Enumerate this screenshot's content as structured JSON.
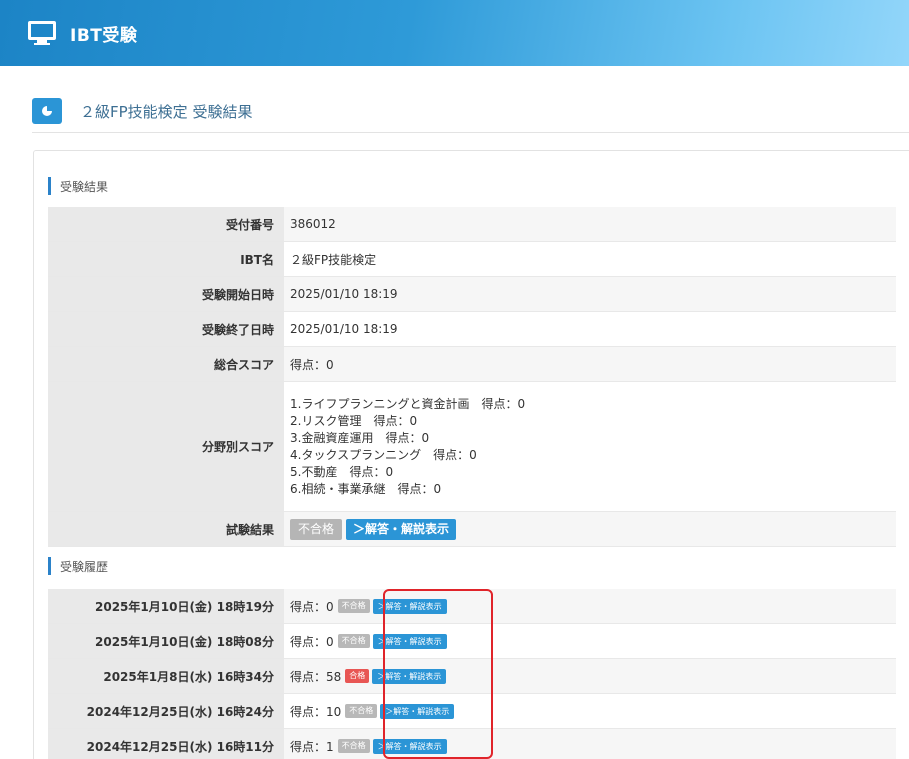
{
  "app": {
    "title": "IBT受験"
  },
  "page": {
    "title": "２級FP技能検定 受験結果"
  },
  "results": {
    "section_label": "受験結果",
    "rows": [
      {
        "key": "受付番号",
        "value": "386012"
      },
      {
        "key": "IBT名",
        "value": "２級FP技能検定"
      },
      {
        "key": "受験開始日時",
        "value": "2025/01/10 18:19"
      },
      {
        "key": "受験終了日時",
        "value": "2025/01/10 18:19"
      },
      {
        "key": "総合スコア",
        "value": "得点：0"
      }
    ],
    "category_label": "分野別スコア",
    "categories": [
      "1.ライフプランニングと資金計画　得点：0",
      "2.リスク管理　得点：0",
      "3.金融資産運用　得点：0",
      "4.タックスプランニング　得点：0",
      "5.不動産　得点：0",
      "6.相続・事業承継　得点：0"
    ],
    "result_label": "試験結果",
    "result_badge": "不合格",
    "answer_button": "＞解答・解説表示"
  },
  "history": {
    "section_label": "受験履歴",
    "rows": [
      {
        "datetime": "2025年1月10日(金) 18時19分",
        "score": "得点：0",
        "status": "不合格",
        "status_type": "fail",
        "button": "＞解答・解説表示"
      },
      {
        "datetime": "2025年1月10日(金) 18時08分",
        "score": "得点：0",
        "status": "不合格",
        "status_type": "fail",
        "button": "＞解答・解説表示"
      },
      {
        "datetime": "2025年1月8日(水) 16時34分",
        "score": "得点：58",
        "status": "合格",
        "status_type": "pass",
        "button": "＞解答・解説表示"
      },
      {
        "datetime": "2024年12月25日(水) 16時24分",
        "score": "得点：10",
        "status": "不合格",
        "status_type": "fail",
        "button": "＞解答・解説表示"
      },
      {
        "datetime": "2024年12月25日(水) 16時11分",
        "score": "得点：1",
        "status": "不合格",
        "status_type": "fail",
        "button": "＞解答・解説表示"
      }
    ]
  },
  "colors": {
    "accent": "#2b95d6",
    "fail": "#b5b5b5",
    "pass": "#e85654",
    "highlight": "#e0242a"
  }
}
